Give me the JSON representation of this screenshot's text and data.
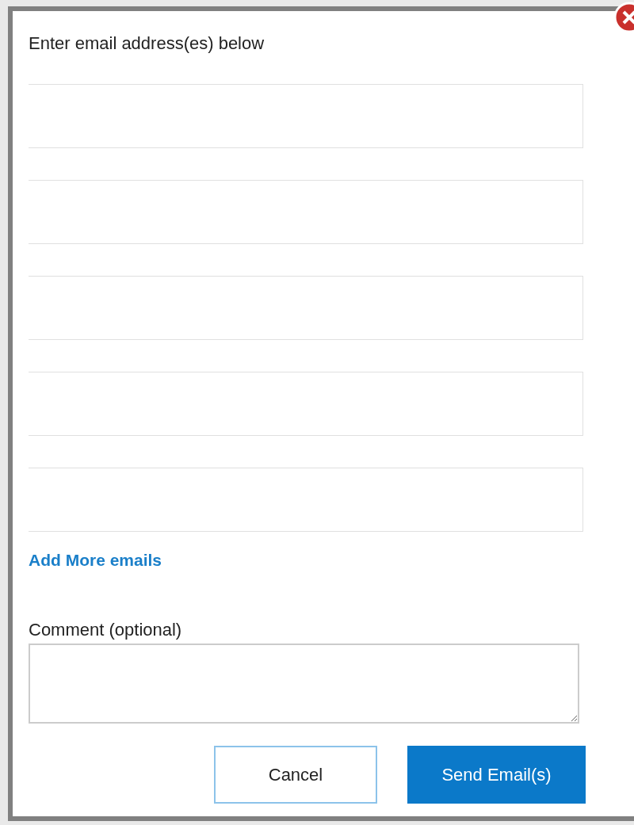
{
  "dialog": {
    "heading": "Enter email address(es) below",
    "email_fields": [
      {
        "kind": "email"
      },
      {
        "kind": "email"
      },
      {
        "kind": "email"
      },
      {
        "kind": "email"
      },
      {
        "kind": "email"
      }
    ],
    "add_link": "Add More emails",
    "comment_label": "Comment (optional)",
    "buttons": [
      {
        "label": "Cancel",
        "kind": "secondary"
      },
      {
        "label": "Send Email(s)",
        "kind": "primary"
      }
    ]
  }
}
